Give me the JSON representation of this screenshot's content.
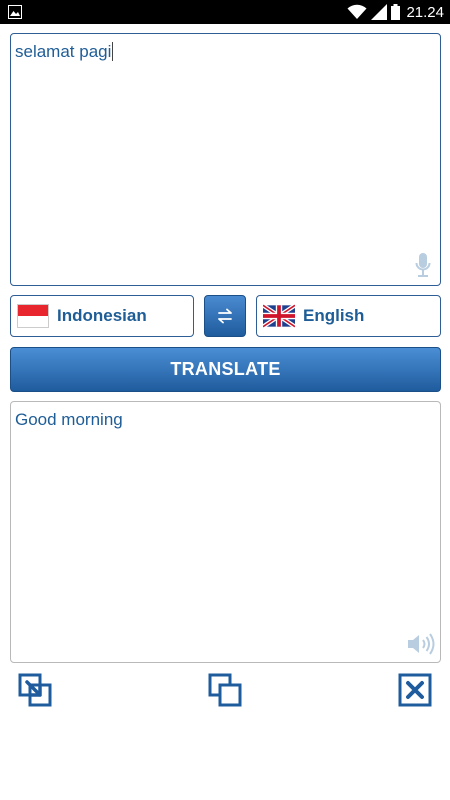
{
  "status_bar": {
    "time": "21.24",
    "icons": [
      "image-icon",
      "wifi-icon",
      "signal-icon",
      "battery-icon"
    ]
  },
  "input": {
    "text": "selamat pagi",
    "mic_icon": "microphone-icon"
  },
  "languages": {
    "source": {
      "label": "Indonesian",
      "flag": "indonesia-flag-icon"
    },
    "target": {
      "label": "English",
      "flag": "uk-flag-icon"
    },
    "swap_icon": "swap-arrows-icon"
  },
  "translate_button": {
    "label": "TRANSLATE"
  },
  "output": {
    "text": "Good morning",
    "speaker_icon": "speaker-icon"
  },
  "bottom_actions": [
    "paste-icon",
    "copy-icon",
    "clear-icon"
  ],
  "colors": {
    "accent": "#1f5c9e",
    "text": "#1f5d96",
    "status_bar": "#000000"
  }
}
